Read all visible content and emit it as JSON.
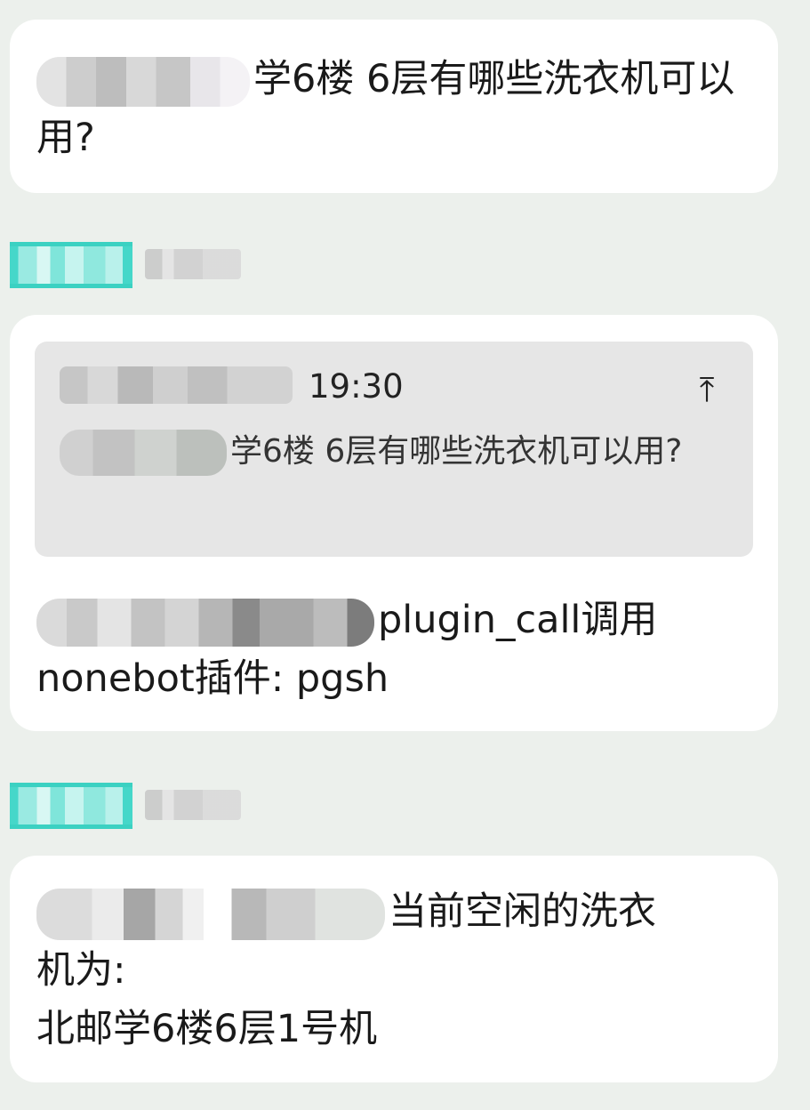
{
  "messages": [
    {
      "id": "msg1",
      "text": "学6楼 6层有哪些洗衣机可以用?"
    },
    {
      "id": "msg2",
      "quote": {
        "time": "19:30",
        "text": "学6楼 6层有哪些洗衣机可以用?"
      },
      "text": "plugin_call调用\nnonebot插件: pgsh"
    },
    {
      "id": "msg3",
      "text": "当前空闲的洗衣\n机为:\n北邮学6楼6层1号机"
    }
  ],
  "icons": {
    "scroll_to_quote": "arrow-up-to-top-icon"
  },
  "colors": {
    "background": "#ecf0ec",
    "bubble": "#ffffff",
    "quote": "#e6e6e6",
    "avatar_accent": "#3bd1c2"
  }
}
